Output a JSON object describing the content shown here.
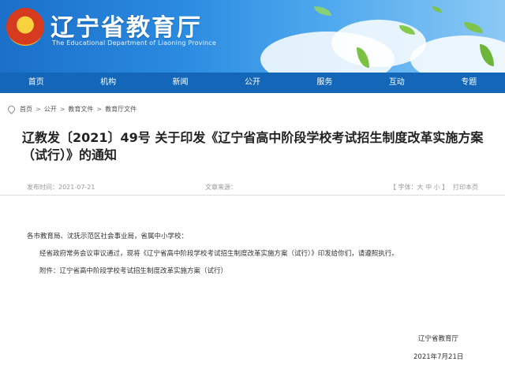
{
  "header": {
    "title": "辽宁省教育厅",
    "subtitle": "The Educational Department of Liaoning Province",
    "emblem_icon": "national-emblem-icon"
  },
  "nav": {
    "items": [
      "首页",
      "机构",
      "新闻",
      "公开",
      "服务",
      "互动",
      "专题"
    ]
  },
  "breadcrumb": {
    "items": [
      "首页",
      "公开",
      "教育文件",
      "教育厅文件"
    ],
    "separator": ">"
  },
  "article": {
    "title": "辽教发〔2021〕49号 关于印发《辽宁省高中阶段学校考试招生制度改革实施方案（试行）》的通知",
    "date": "发布时间：2021-07-21",
    "source": "文章来源：",
    "font_size_control": "【 字体：大 中 小 】",
    "print": "打印本页",
    "addressee": "各市教育局、沈抚示范区社会事业局，省属中小学校：",
    "paragraph": "经省政府常务会议审议通过，现将《辽宁省高中阶段学校考试招生制度改革实施方案（试行）》印发给你们，请遵照执行。",
    "attachment": "附件：辽宁省高中阶段学校考试招生制度改革实施方案（试行）",
    "signature": "辽宁省教育厅",
    "signature_date": "2021年7月21日"
  },
  "colors": {
    "nav_bg": "#1366b8",
    "banner_start": "#1b6fc9",
    "banner_end": "#8cc9f5"
  }
}
